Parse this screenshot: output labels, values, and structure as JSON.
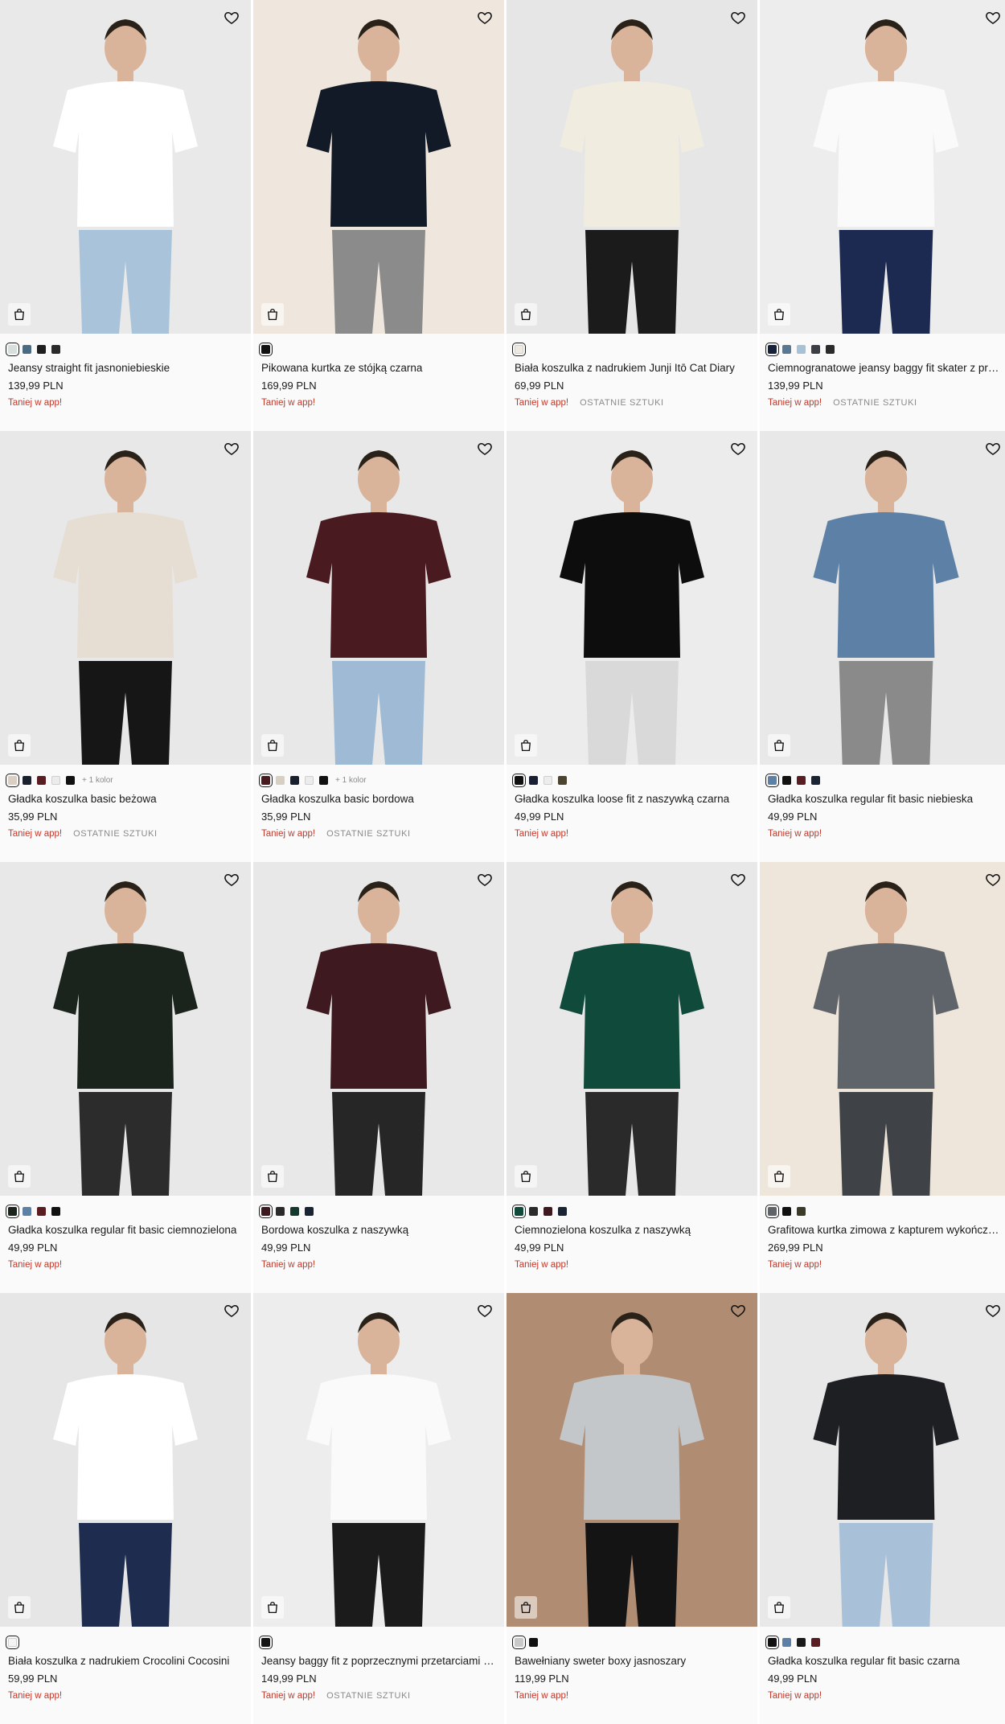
{
  "icons": {
    "favorite": "heart-icon",
    "cart": "shopping-bag-icon"
  },
  "products": [
    {
      "name": "Jeansy straight fit jasnoniebieskie",
      "price": "139,99 PLN",
      "promo": "Taniej w app!",
      "last": "",
      "more": "",
      "bg": "#e9e9e9",
      "top": "#ffffff",
      "bottom": "#a9c4da",
      "swatches": [
        "#d7dfdc",
        "#4b6b82",
        "#1f1f1f",
        "#2a2a2a"
      ]
    },
    {
      "name": "Pikowana kurtka ze stójką czarna",
      "price": "169,99 PLN",
      "promo": "Taniej w app!",
      "last": "",
      "more": "",
      "bg": "#efe7dd",
      "top": "#121a27",
      "bottom": "#8b8b8b",
      "swatches": [
        "#111111"
      ]
    },
    {
      "name": "Biała koszulka z nadrukiem Junji Itō Cat Diary",
      "price": "69,99 PLN",
      "promo": "Taniej w app!",
      "last": "OSTATNIE SZTUKI",
      "more": "",
      "bg": "#e6e6e6",
      "top": "#f1ece0",
      "bottom": "#1b1b1b",
      "swatches": [
        "#efeadf"
      ]
    },
    {
      "name": "Ciemnogranatowe jeansy baggy fit skater z przetarciami",
      "price": "139,99 PLN",
      "promo": "Taniej w app!",
      "last": "OSTATNIE SZTUKI",
      "more": "",
      "bg": "#ededed",
      "top": "#fafafa",
      "bottom": "#1c2a52",
      "swatches": [
        "#18213a",
        "#5a7894",
        "#a7c1d6",
        "#3c3f45",
        "#2b2b2b"
      ]
    },
    {
      "name": "Gładka koszulka basic beżowa",
      "price": "35,99 PLN",
      "promo": "Taniej w app!",
      "last": "OSTATNIE SZTUKI",
      "more": "+ 1 kolor",
      "bg": "#e8e8e8",
      "top": "#e6ddd3",
      "bottom": "#161616",
      "swatches": [
        "#d9cfc3",
        "#1a1f2e",
        "#5a1e22",
        "#ececec",
        "#111111"
      ]
    },
    {
      "name": "Gładka koszulka basic bordowa",
      "price": "35,99 PLN",
      "promo": "Taniej w app!",
      "last": "OSTATNIE SZTUKI",
      "more": "+ 1 kolor",
      "bg": "#e8e8e8",
      "top": "#4a1a21",
      "bottom": "#9fbad4",
      "swatches": [
        "#4a1a21",
        "#d8cfc3",
        "#1a1f2e",
        "#ececec",
        "#111111"
      ]
    },
    {
      "name": "Gładka koszulka loose fit z naszywką czarna",
      "price": "49,99 PLN",
      "promo": "Taniej w app!",
      "last": "",
      "more": "",
      "bg": "#ececec",
      "top": "#0d0d0d",
      "bottom": "#d9d9d9",
      "swatches": [
        "#111111",
        "#1a1f33",
        "#ededed",
        "#4a4430"
      ]
    },
    {
      "name": "Gładka koszulka regular fit basic niebieska",
      "price": "49,99 PLN",
      "promo": "Taniej w app!",
      "last": "",
      "more": "",
      "bg": "#e8e8e8",
      "top": "#5d81a6",
      "bottom": "#8a8a8a",
      "swatches": [
        "#5d81a6",
        "#111111",
        "#5a1e22",
        "#1b2435"
      ]
    },
    {
      "name": "Gładka koszulka regular fit basic ciemnozielona",
      "price": "49,99 PLN",
      "promo": "Taniej w app!",
      "last": "",
      "more": "",
      "bg": "#e8e8e8",
      "top": "#1a231c",
      "bottom": "#2c2c2c",
      "swatches": [
        "#1a231c",
        "#5d81a6",
        "#5a1e22",
        "#111111"
      ]
    },
    {
      "name": "Bordowa koszulka z naszywką",
      "price": "49,99 PLN",
      "promo": "Taniej w app!",
      "last": "",
      "more": "",
      "bg": "#e8e8e8",
      "top": "#3e1a20",
      "bottom": "#262626",
      "swatches": [
        "#3e1a20",
        "#2b2b2b",
        "#143a30",
        "#1b2435"
      ]
    },
    {
      "name": "Ciemnozielona koszulka z naszywką",
      "price": "49,99 PLN",
      "promo": "Taniej w app!",
      "last": "",
      "more": "",
      "bg": "#e8e8e8",
      "top": "#0f4a3a",
      "bottom": "#2a2a2a",
      "swatches": [
        "#0f4a3a",
        "#2b2b2b",
        "#3e1a20",
        "#1b2435"
      ]
    },
    {
      "name": "Grafitowa kurtka zimowa z kapturem wykończonym sztucznym futerkiem",
      "price": "269,99 PLN",
      "promo": "Taniej w app!",
      "last": "",
      "more": "",
      "bg": "#efe6db",
      "top": "#5f646b",
      "bottom": "#3f4347",
      "swatches": [
        "#5f646b",
        "#111111",
        "#3c3a28"
      ]
    },
    {
      "name": "Biała koszulka z nadrukiem Crocolini Cocosini",
      "price": "59,99 PLN",
      "promo": "Taniej w app!",
      "last": "",
      "more": "",
      "bg": "#e6e6e6",
      "top": "#ffffff",
      "bottom": "#1d2c4f",
      "swatches": [
        "#f4f4f4"
      ]
    },
    {
      "name": "Jeansy baggy fit z poprzecznymi przetarciami czarne",
      "price": "149,99 PLN",
      "promo": "Taniej w app!",
      "last": "OSTATNIE SZTUKI",
      "more": "",
      "bg": "#ededed",
      "top": "#fafafa",
      "bottom": "#1b1b1b",
      "swatches": [
        "#161616"
      ]
    },
    {
      "name": "Bawełniany sweter boxy jasnoszary",
      "price": "119,99 PLN",
      "promo": "Taniej w app!",
      "last": "",
      "more": "",
      "bg": "#b08d72",
      "top": "#c4c7ca",
      "bottom": "#141414",
      "swatches": [
        "#c9c9c9",
        "#111111"
      ]
    },
    {
      "name": "Gładka koszulka regular fit basic czarna",
      "price": "49,99 PLN",
      "promo": "Taniej w app!",
      "last": "",
      "more": "",
      "bg": "#e8e8e8",
      "top": "#1e1f22",
      "bottom": "#a9c1d8",
      "swatches": [
        "#111111",
        "#5d81a6",
        "#1a1a1a",
        "#5a1e22"
      ]
    }
  ]
}
